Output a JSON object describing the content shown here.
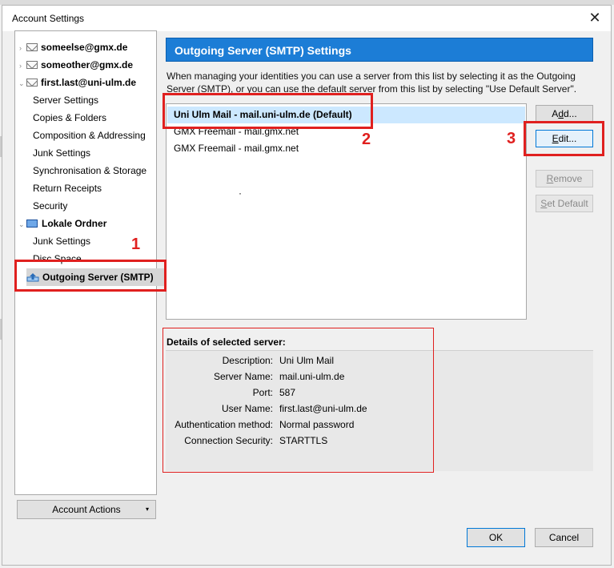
{
  "window": {
    "title": "Account Settings",
    "close_glyph": "✕"
  },
  "tree": {
    "accounts": [
      {
        "label": "someelse@gmx.de",
        "expanded": false
      },
      {
        "label": "someother@gmx.de",
        "expanded": false
      },
      {
        "label": "first.last@uni-ulm.de",
        "expanded": true
      }
    ],
    "account_children": [
      "Server Settings",
      "Copies & Folders",
      "Composition & Addressing",
      "Junk Settings",
      "Synchronisation & Storage",
      "Return Receipts",
      "Security"
    ],
    "local_folders": {
      "label": "Lokale Ordner"
    },
    "local_children": [
      "Junk Settings",
      "Disc Space"
    ],
    "outgoing": {
      "label": "Outgoing Server (SMTP)"
    }
  },
  "account_actions": {
    "label": "Account Actions",
    "caret": "▾"
  },
  "panel": {
    "header": "Outgoing Server (SMTP) Settings",
    "description": "When managing your identities you can use a server from this list by selecting it as the Outgoing Server (SMTP), or you can use the default server from this list by selecting \"Use Default Server\".",
    "servers": [
      "Uni Ulm Mail - mail.uni-ulm.de (Default)",
      "GMX Freemail - mail.gmx.net",
      "GMX Freemail - mail.gmx.net"
    ],
    "dot": "·",
    "buttons": {
      "add": {
        "pre": "A",
        "ul": "d",
        "post": "d..."
      },
      "edit": {
        "pre": "",
        "ul": "E",
        "post": "dit..."
      },
      "remove": {
        "pre": "",
        "ul": "R",
        "post": "emove"
      },
      "set_default": {
        "pre": "",
        "ul": "S",
        "post": "et Default"
      }
    }
  },
  "details": {
    "title": "Details of selected server:",
    "rows": [
      {
        "label": "Description:",
        "value": "Uni Ulm Mail"
      },
      {
        "label": "Server Name:",
        "value": "mail.uni-ulm.de"
      },
      {
        "label": "Port:",
        "value": "587"
      },
      {
        "label": "User Name:",
        "value": "first.last@uni-ulm.de"
      },
      {
        "label": "Authentication method:",
        "value": "Normal password"
      },
      {
        "label": "Connection Security:",
        "value": "STARTTLS"
      }
    ]
  },
  "annotations": {
    "n1": "1",
    "n2": "2",
    "n3": "3",
    "color": "#e0201f"
  },
  "footer": {
    "ok": "OK",
    "cancel": "Cancel"
  }
}
